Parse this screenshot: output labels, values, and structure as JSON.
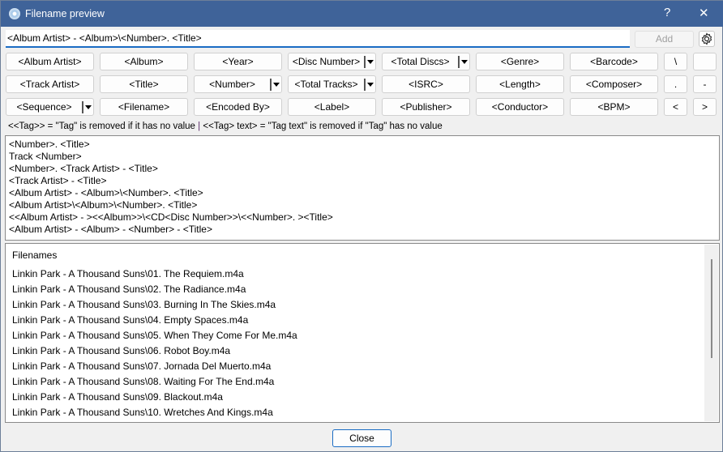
{
  "window": {
    "title": "Filename preview",
    "help_label": "?",
    "close_glyph": "✕"
  },
  "pattern": {
    "value": "<Album Artist> - <Album>\\<Number>. <Title>"
  },
  "add_label": "Add",
  "tag_buttons": [
    [
      {
        "label": "<Album Artist>"
      },
      {
        "label": "<Album>"
      },
      {
        "label": "<Year>"
      },
      {
        "label": "<Disc Number>",
        "dropdown": true
      },
      {
        "label": "<Total Discs>",
        "dropdown": true
      },
      {
        "label": "<Genre>"
      },
      {
        "label": "<Barcode>"
      },
      {
        "label": "\\"
      },
      {
        "label": ""
      }
    ],
    [
      {
        "label": "<Track Artist>"
      },
      {
        "label": "<Title>"
      },
      {
        "label": "<Number>",
        "dropdown": true
      },
      {
        "label": "<Total Tracks>",
        "dropdown": true
      },
      {
        "label": "<ISRC>"
      },
      {
        "label": "<Length>"
      },
      {
        "label": "<Composer>"
      },
      {
        "label": "."
      },
      {
        "label": "-"
      }
    ],
    [
      {
        "label": "<Sequence>",
        "dropdown": true
      },
      {
        "label": "<Filename>"
      },
      {
        "label": "<Encoded By>"
      },
      {
        "label": "<Label>"
      },
      {
        "label": "<Publisher>"
      },
      {
        "label": "<Conductor>"
      },
      {
        "label": "<BPM>"
      },
      {
        "label": "<"
      },
      {
        "label": ">"
      }
    ]
  ],
  "help": {
    "part1": "<<Tag>> = \"Tag\" is removed if it has no value",
    "sep": "|",
    "part2": "<<Tag> text> = \"Tag text\" is removed if \"Tag\" has no value"
  },
  "templates": [
    "<Number>. <Title>",
    "Track <Number>",
    "<Number>. <Track Artist> - <Title>",
    "<Track Artist> - <Title>",
    "<Album Artist> - <Album>\\<Number>. <Title>",
    "<Album Artist>\\<Album>\\<Number>. <Title>",
    "<<Album Artist> - ><<Album>>\\<CD<Disc Number>>\\<<Number>. ><Title>",
    "<Album Artist> - <Album> - <Number> - <Title>"
  ],
  "filenames": {
    "header": "Filenames",
    "items": [
      "Linkin Park - A Thousand Suns\\01. The Requiem.m4a",
      "Linkin Park - A Thousand Suns\\02. The Radiance.m4a",
      "Linkin Park - A Thousand Suns\\03. Burning In The Skies.m4a",
      "Linkin Park - A Thousand Suns\\04. Empty Spaces.m4a",
      "Linkin Park - A Thousand Suns\\05. When They Come For Me.m4a",
      "Linkin Park - A Thousand Suns\\06. Robot Boy.m4a",
      "Linkin Park - A Thousand Suns\\07. Jornada Del Muerto.m4a",
      "Linkin Park - A Thousand Suns\\08. Waiting For The End.m4a",
      "Linkin Park - A Thousand Suns\\09. Blackout.m4a",
      "Linkin Park - A Thousand Suns\\10. Wretches And Kings.m4a"
    ]
  },
  "close_label": "Close"
}
